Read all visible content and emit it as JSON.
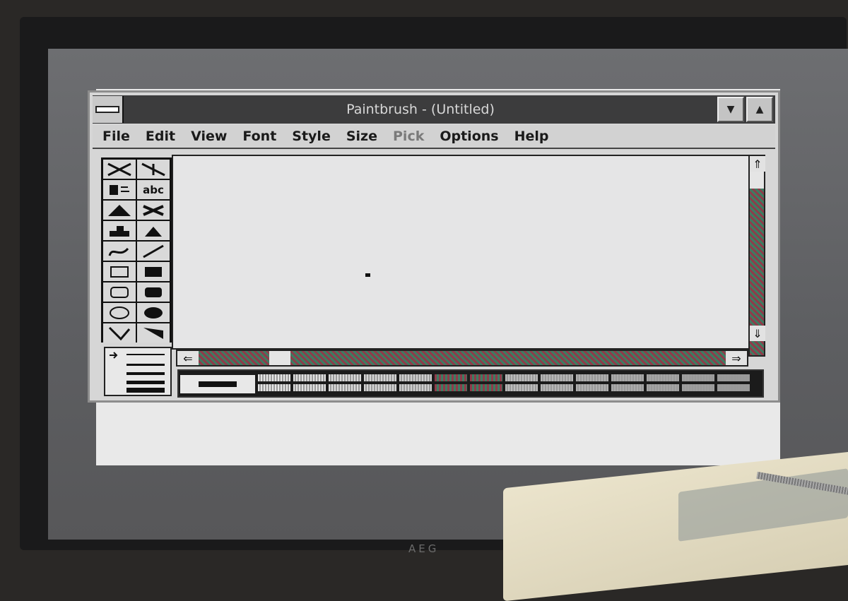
{
  "window": {
    "title": "Paintbrush - (Untitled)"
  },
  "titlebar": {
    "minimize_icon": "▼",
    "maximize_icon": "▲"
  },
  "menu": [
    {
      "label": "File",
      "enabled": true
    },
    {
      "label": "Edit",
      "enabled": true
    },
    {
      "label": "View",
      "enabled": true
    },
    {
      "label": "Font",
      "enabled": true
    },
    {
      "label": "Style",
      "enabled": true
    },
    {
      "label": "Size",
      "enabled": true
    },
    {
      "label": "Pick",
      "enabled": false
    },
    {
      "label": "Options",
      "enabled": true
    },
    {
      "label": "Help",
      "enabled": true
    }
  ],
  "tools": [
    {
      "name": "scissors-icon"
    },
    {
      "name": "pick-icon"
    },
    {
      "name": "airbrush-icon"
    },
    {
      "name": "text-tool",
      "text": "abc"
    },
    {
      "name": "color-eraser-icon"
    },
    {
      "name": "eraser-icon"
    },
    {
      "name": "paint-roller-icon"
    },
    {
      "name": "brush-icon"
    },
    {
      "name": "curve-icon"
    },
    {
      "name": "line-icon"
    },
    {
      "name": "box-icon"
    },
    {
      "name": "filled-box-icon"
    },
    {
      "name": "rounded-box-icon"
    },
    {
      "name": "filled-rounded-box-icon"
    },
    {
      "name": "circle-icon"
    },
    {
      "name": "filled-circle-icon"
    },
    {
      "name": "polygon-icon"
    },
    {
      "name": "filled-polygon-icon"
    }
  ],
  "scrollbars": {
    "up_arrow": "⇑",
    "down_arrow": "⇓",
    "left_arrow": "⇐",
    "right_arrow": "⇒",
    "horizontal_position": 0.14
  },
  "colors": {
    "titlebar": "#3c3c3d",
    "scroll_pattern_a": "#8f3b4a",
    "scroll_pattern_b": "#3c7d62",
    "canvas": "#e5e5e6"
  },
  "monitor": {
    "brand": "AEG"
  }
}
